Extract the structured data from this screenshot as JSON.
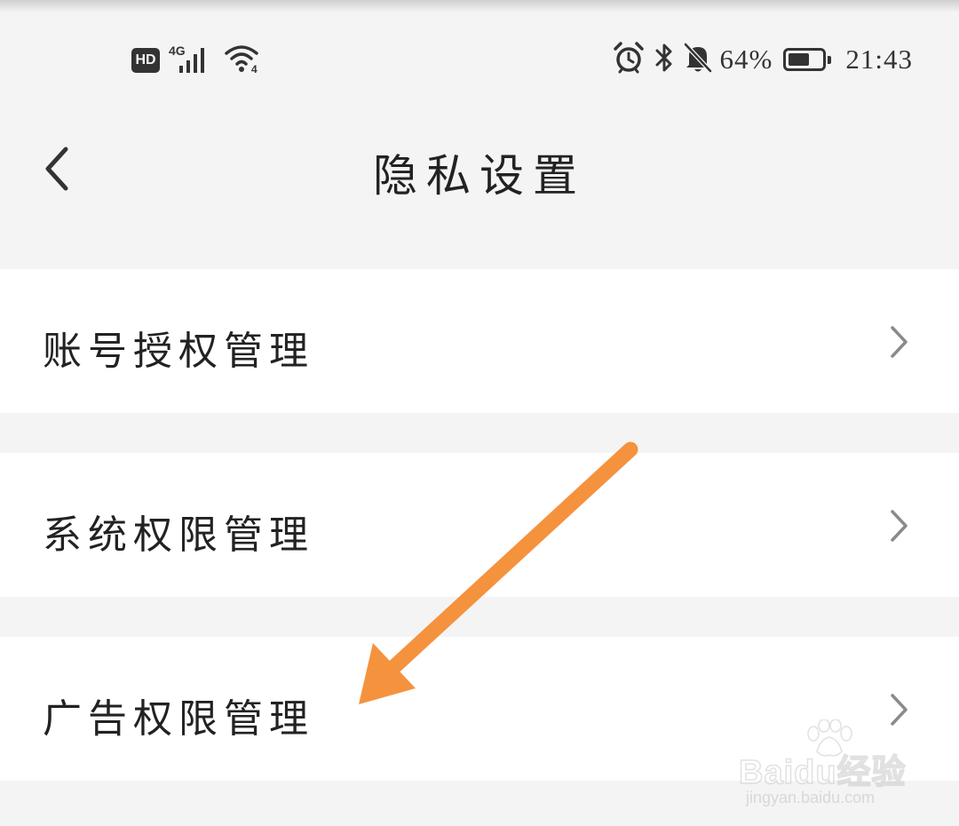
{
  "status_bar": {
    "network_badge": "HD",
    "network_type": "4G",
    "wifi_tag": "4",
    "battery_text": "64%",
    "battery_level": 0.64,
    "time": "21:43",
    "icons": [
      "hd-badge-icon",
      "signal-icon",
      "wifi-icon",
      "alarm-icon",
      "bluetooth-icon",
      "bell-off-icon",
      "battery-icon"
    ]
  },
  "header": {
    "title": "隐私设置",
    "back_icon": "chevron-left-icon"
  },
  "settings": {
    "items": [
      {
        "label": "账号授权管理",
        "icon": "chevron-right-icon"
      },
      {
        "label": "系统权限管理",
        "icon": "chevron-right-icon"
      },
      {
        "label": "广告权限管理",
        "icon": "chevron-right-icon"
      }
    ]
  },
  "annotation": {
    "arrow_color": "#f5923e"
  },
  "watermark": {
    "brand": "Baidu经验",
    "url": "jingyan.baidu.com"
  },
  "colors": {
    "background": "#f4f4f4",
    "row_background": "#ffffff",
    "text": "#222222",
    "chevron": "#8a8a8a"
  }
}
